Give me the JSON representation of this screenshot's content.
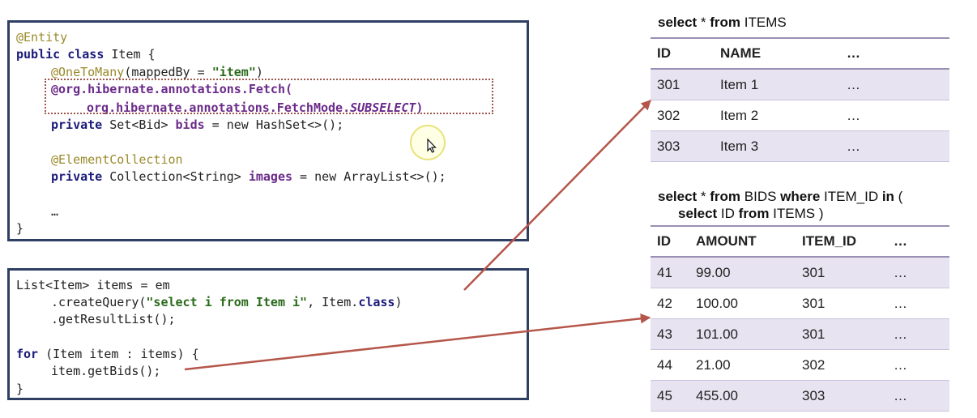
{
  "entity_code": {
    "l1": "@Entity",
    "l2_kw": "public class",
    "l2_rest": " Item {",
    "l3_ann": "@OneToMany",
    "l3_mid": "(mappedBy = ",
    "l3_str": "\"item\"",
    "l3_end": ")",
    "l4": "@org.hibernate.annotations.Fetch(",
    "l5_pre": "org.hibernate.annotations.FetchMode.",
    "l5_ital": "SUBSELECT",
    "l5_end": ")",
    "l6_kw": "private",
    "l6_type": " Set<Bid> ",
    "l6_fld": "bids",
    "l6_rest": " = new HashSet<>();",
    "l7": "@ElementCollection",
    "l8_kw": "private",
    "l8_type": " Collection<String> ",
    "l8_fld": "images",
    "l8_rest": " = new ArrayList<>();",
    "l9": "…",
    "l10": "}"
  },
  "query_code": {
    "l1": "List<Item> items = em",
    "l2_pre": ".createQuery(",
    "l2_str": "\"select i from Item i\"",
    "l2_mid": ", Item.",
    "l2_kw": "class",
    "l2_end": ")",
    "l3": ".getResultList();",
    "l4_kw": "for",
    "l4_rest": " (Item item : items) {",
    "l5": "item.getBids();",
    "l6": "}"
  },
  "items_sql": {
    "kw1": "select",
    "t1": " * ",
    "kw2": "from",
    "t2": " ITEMS"
  },
  "items_table": {
    "headers": [
      "ID",
      "NAME",
      "…"
    ],
    "rows": [
      [
        "301",
        "Item 1",
        "…"
      ],
      [
        "302",
        "Item 2",
        "…"
      ],
      [
        "303",
        "Item 3",
        "…"
      ]
    ]
  },
  "bids_sql": {
    "kw1": "select",
    "t1": " * ",
    "kw2": "from",
    "t2": " BIDS ",
    "kw3": "where",
    "t3": " ITEM_ID ",
    "kw4": "in",
    "t4": "  (",
    "kw5": "select",
    "t5": " ID ",
    "kw6": "from",
    "t6": " ITEMS )"
  },
  "bids_table": {
    "headers": [
      "ID",
      "AMOUNT",
      "ITEM_ID",
      "…"
    ],
    "rows": [
      [
        "41",
        "99.00",
        "301",
        "…"
      ],
      [
        "42",
        "100.00",
        "301",
        "…"
      ],
      [
        "43",
        "101.00",
        "301",
        "…"
      ],
      [
        "44",
        "21.00",
        "302",
        "…"
      ],
      [
        "45",
        "455.00",
        "303",
        "…"
      ]
    ]
  },
  "colors": {
    "arrow": "#b5564a",
    "box_border": "#2e3f63",
    "row_tint": "#e7e3f0"
  }
}
